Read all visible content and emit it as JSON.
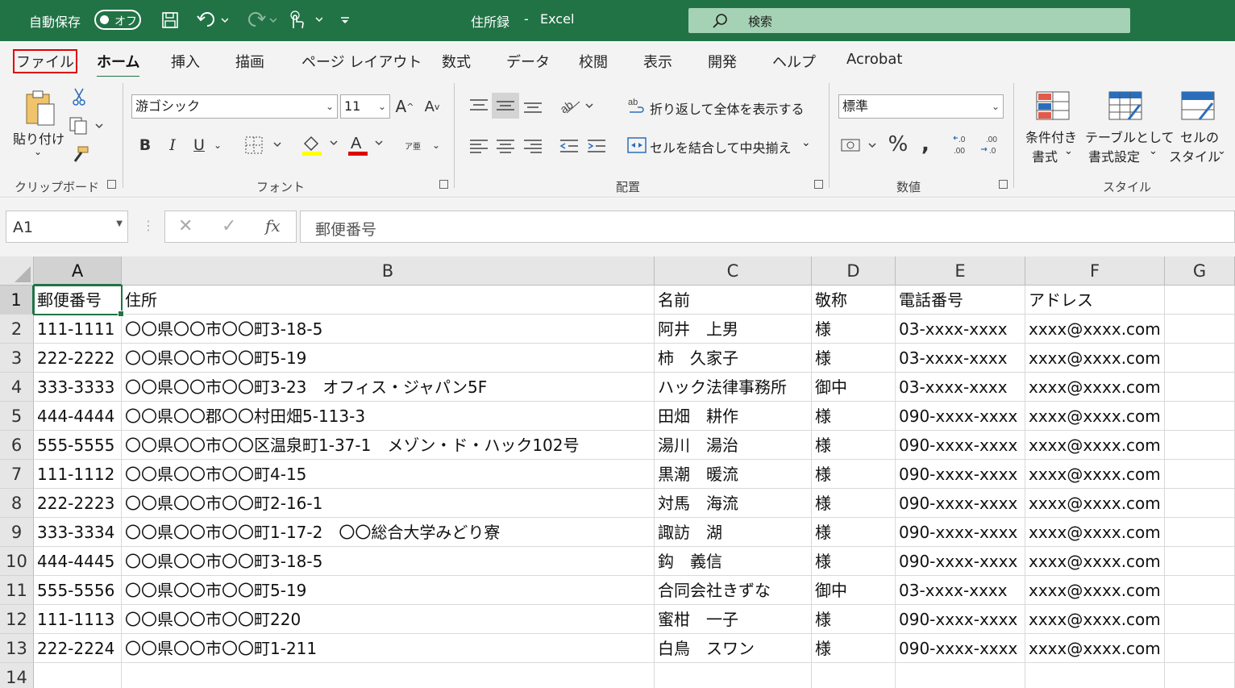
{
  "titlebar": {
    "autosave_label": "自動保存",
    "autosave_state": "オフ",
    "file_name": "住所録",
    "separator": "-",
    "app_name": "Excel",
    "search_placeholder": "検索"
  },
  "tabs": [
    "ファイル",
    "ホーム",
    "挿入",
    "描画",
    "ページ レイアウト",
    "数式",
    "データ",
    "校閲",
    "表示",
    "開発",
    "ヘルプ",
    "Acrobat"
  ],
  "ribbon": {
    "clipboard": {
      "paste_label": "貼り付け",
      "group": "クリップボード"
    },
    "font": {
      "name": "游ゴシック",
      "size": "11",
      "group": "フォント",
      "phonetic_glyph": "ア亜"
    },
    "alignment": {
      "wrap_label": "折り返して全体を表示する",
      "merge_label": "セルを結合して中央揃え",
      "group": "配置"
    },
    "number": {
      "format": "標準",
      "group": "数値"
    },
    "styles": {
      "cond_line1": "条件付き",
      "cond_line2": "書式",
      "table_line1": "テーブルとして",
      "table_line2": "書式設定",
      "cell_line1": "セルの",
      "cell_line2": "スタイル",
      "group": "スタイル"
    }
  },
  "formula_bar": {
    "name_box": "A1",
    "fx": "fx",
    "content": "郵便番号"
  },
  "colors": {
    "accent": "#217346",
    "file_tab_outline": "#e00000"
  },
  "grid": {
    "columns": [
      "A",
      "B",
      "C",
      "D",
      "E",
      "F",
      "G"
    ],
    "row_numbers": [
      "1",
      "2",
      "3",
      "4",
      "5",
      "6",
      "7",
      "8",
      "9",
      "10",
      "11",
      "12",
      "13",
      "14"
    ],
    "rows": [
      [
        "郵便番号",
        "住所",
        "名前",
        "敬称",
        "電話番号",
        "アドレス"
      ],
      [
        "111-1111",
        "〇〇県〇〇市〇〇町3-18-5",
        "阿井　上男",
        "様",
        "03-xxxx-xxxx",
        "xxxx@xxxx.com"
      ],
      [
        "222-2222",
        "〇〇県〇〇市〇〇町5-19",
        "柿　久家子",
        "様",
        "03-xxxx-xxxx",
        "xxxx@xxxx.com"
      ],
      [
        "333-3333",
        "〇〇県〇〇市〇〇町3-23　オフィス・ジャパン5F",
        "ハック法律事務所",
        "御中",
        "03-xxxx-xxxx",
        "xxxx@xxxx.com"
      ],
      [
        "444-4444",
        "〇〇県〇〇郡〇〇村田畑5-113-3",
        "田畑　耕作",
        "様",
        "090-xxxx-xxxx",
        "xxxx@xxxx.com"
      ],
      [
        "555-5555",
        "〇〇県〇〇市〇〇区温泉町1-37-1　メゾン・ド・ハック102号",
        "湯川　湯治",
        "様",
        "090-xxxx-xxxx",
        "xxxx@xxxx.com"
      ],
      [
        "111-1112",
        "〇〇県〇〇市〇〇町4-15",
        "黒潮　暖流",
        "様",
        "090-xxxx-xxxx",
        "xxxx@xxxx.com"
      ],
      [
        "222-2223",
        "〇〇県〇〇市〇〇町2-16-1",
        "対馬　海流",
        "様",
        "090-xxxx-xxxx",
        "xxxx@xxxx.com"
      ],
      [
        "333-3334",
        "〇〇県〇〇市〇〇町1-17-2　〇〇総合大学みどり寮",
        "諏訪　湖",
        "様",
        "090-xxxx-xxxx",
        "xxxx@xxxx.com"
      ],
      [
        "444-4445",
        "〇〇県〇〇市〇〇町3-18-5",
        "鈎　義信",
        "様",
        "090-xxxx-xxxx",
        "xxxx@xxxx.com"
      ],
      [
        "555-5556",
        "〇〇県〇〇市〇〇町5-19",
        "合同会社きずな",
        "御中",
        "03-xxxx-xxxx",
        "xxxx@xxxx.com"
      ],
      [
        "111-1113",
        "〇〇県〇〇市〇〇町220",
        "蜜柑　一子",
        "様",
        "090-xxxx-xxxx",
        "xxxx@xxxx.com"
      ],
      [
        "222-2224",
        "〇〇県〇〇市〇〇町1-211",
        "白鳥　スワン",
        "様",
        "090-xxxx-xxxx",
        "xxxx@xxxx.com"
      ],
      [
        "",
        "",
        "",
        "",
        "",
        ""
      ]
    ]
  }
}
